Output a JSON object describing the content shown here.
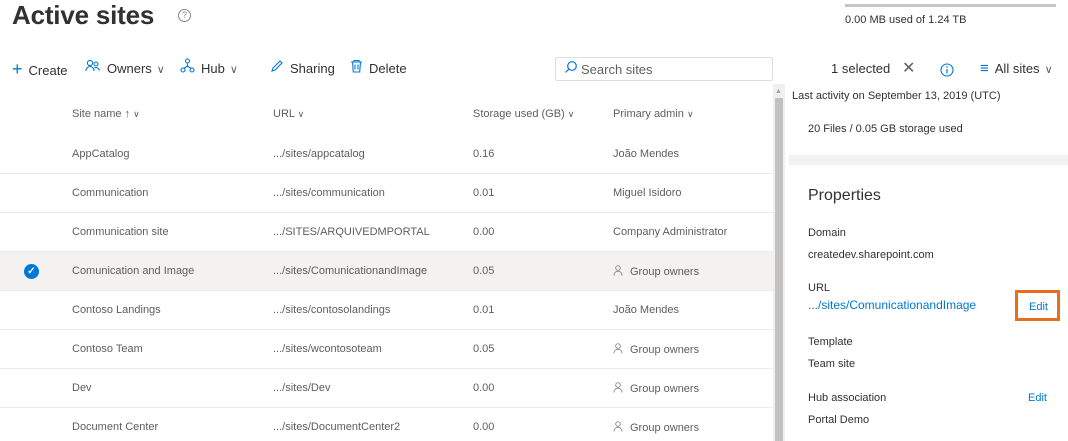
{
  "page": {
    "title": "Active sites",
    "title_info_icon": "info-circle-icon"
  },
  "storage": {
    "text": "0.00 MB used of 1.24 TB",
    "fraction_used": 0.0
  },
  "toolbar": {
    "create_label": "Create",
    "owners_label": "Owners",
    "hub_label": "Hub",
    "sharing_label": "Sharing",
    "delete_label": "Delete",
    "search_placeholder": "Search sites",
    "selected_label": "1 selected",
    "view_label": "All sites"
  },
  "table": {
    "columns": {
      "site_name": "Site name ↑",
      "url": "URL",
      "storage": "Storage used (GB)",
      "admin": "Primary admin"
    },
    "rows": [
      {
        "name": "AppCatalog",
        "url": ".../sites/appcatalog",
        "storage": "0.16",
        "admin": "João Mendes",
        "group": false,
        "selected": false
      },
      {
        "name": "Communication",
        "url": ".../sites/communication",
        "storage": "0.01",
        "admin": "Miguel Isidoro",
        "group": false,
        "selected": false
      },
      {
        "name": "Communication site",
        "url": ".../SITES/ARQUIVEDMPORTAL",
        "storage": "0.00",
        "admin": "Company Administrator",
        "group": false,
        "selected": false
      },
      {
        "name": "Comunication and Image",
        "url": ".../sites/ComunicationandImage",
        "storage": "0.05",
        "admin": "Group owners",
        "group": true,
        "selected": true
      },
      {
        "name": "Contoso Landings",
        "url": ".../sites/contosolandings",
        "storage": "0.01",
        "admin": "João Mendes",
        "group": false,
        "selected": false
      },
      {
        "name": "Contoso Team",
        "url": ".../sites/wcontosoteam",
        "storage": "0.05",
        "admin": "Group owners",
        "group": true,
        "selected": false
      },
      {
        "name": "Dev",
        "url": ".../sites/Dev",
        "storage": "0.00",
        "admin": "Group owners",
        "group": true,
        "selected": false
      },
      {
        "name": "Document Center",
        "url": ".../sites/DocumentCenter2",
        "storage": "0.00",
        "admin": "Group owners",
        "group": true,
        "selected": false
      }
    ]
  },
  "panel": {
    "last_activity": "Last activity on September 13, 2019 (UTC)",
    "files_summary": "20 Files / 0.05 GB storage used",
    "properties_heading": "Properties",
    "domain_label": "Domain",
    "domain_value": "createdev.sharepoint.com",
    "url_label": "URL",
    "url_value": ".../sites/ComunicationandImage",
    "url_edit": "Edit",
    "template_label": "Template",
    "template_value": "Team site",
    "hub_label": "Hub association",
    "hub_value": "Portal Demo",
    "hub_edit": "Edit"
  },
  "colors": {
    "accent": "#0078d4",
    "highlight": "#e86d1f",
    "selected_row": "#f3f2f1"
  }
}
